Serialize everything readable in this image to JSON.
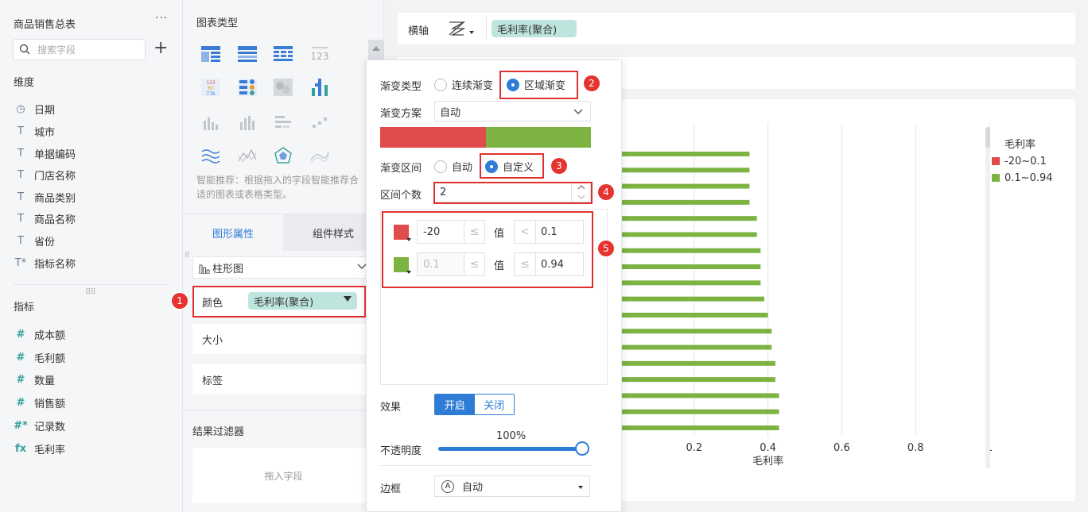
{
  "left": {
    "table_title": "商品销售总表",
    "more": "···",
    "search_placeholder": "搜索字段",
    "add": "+",
    "dimension_label": "维度",
    "dimensions": [
      {
        "icon": "clock-icon",
        "glyph": "◷",
        "label": "日期"
      },
      {
        "icon": "text-type-icon",
        "glyph": "T",
        "label": "城市"
      },
      {
        "icon": "text-type-icon",
        "glyph": "T",
        "label": "单据编码"
      },
      {
        "icon": "text-type-icon",
        "glyph": "T",
        "label": "门店名称"
      },
      {
        "icon": "text-type-icon",
        "glyph": "T",
        "label": "商品类别"
      },
      {
        "icon": "text-type-icon",
        "glyph": "T",
        "label": "商品名称"
      },
      {
        "icon": "text-type-icon",
        "glyph": "T",
        "label": "省份"
      },
      {
        "icon": "text-type-icon",
        "glyph": "T*",
        "label": "指标名称"
      }
    ],
    "measure_label": "指标",
    "measures": [
      {
        "icon": "number-type-icon",
        "glyph": "#",
        "label": "成本额"
      },
      {
        "icon": "number-type-icon",
        "glyph": "#",
        "label": "毛利额"
      },
      {
        "icon": "number-type-icon",
        "glyph": "#",
        "label": "数量"
      },
      {
        "icon": "number-type-icon",
        "glyph": "#",
        "label": "销售额"
      },
      {
        "icon": "number-type-icon",
        "glyph": "#*",
        "label": "记录数"
      },
      {
        "icon": "formula-icon",
        "glyph": "fx",
        "label": "毛利率"
      }
    ]
  },
  "mid": {
    "chart_type_title": "图表类型",
    "smart_tip": "智能推荐：根据拖入的字段智能推荐合适的图表或表格类型。",
    "tab_active": "图形属性",
    "tab_inactive": "组件样式",
    "chart_select": "柱形图",
    "color_label": "颜色",
    "color_field": "毛利率(聚合)",
    "size_label": "大小",
    "label_label": "标签",
    "filter_title": "结果过滤器",
    "drop_hint": "拖入字段"
  },
  "canvas": {
    "axis_label": "横轴",
    "axis_field": "毛利率(聚合)",
    "x_axis_title": "毛利率",
    "legend_title": "毛利率",
    "legend": [
      {
        "label": "-20~0.1",
        "color": "#e04b4b"
      },
      {
        "label": "0.1~0.94",
        "color": "#7cb342"
      }
    ]
  },
  "chart_data": {
    "type": "bar",
    "orientation": "horizontal",
    "xlabel": "毛利率",
    "x_ticks": [
      "0.2",
      "0.4",
      "0.6",
      "0.8",
      "1"
    ],
    "xlim": [
      0,
      1
    ],
    "values": [
      0.35,
      0.35,
      0.35,
      0.35,
      0.37,
      0.37,
      0.38,
      0.38,
      0.38,
      0.39,
      0.4,
      0.41,
      0.41,
      0.42,
      0.42,
      0.43,
      0.43,
      0.43
    ],
    "bar_color": "#7cb342",
    "grid": true
  },
  "popup": {
    "gradient_type_label": "渐变类型",
    "gradient_continuous": "连续渐变",
    "gradient_region": "区域渐变",
    "scheme_label": "渐变方案",
    "scheme_value": "自动",
    "gradient_colors": [
      "#e04b4b",
      "#7cb342"
    ],
    "interval_label": "渐变区间",
    "interval_auto": "自动",
    "interval_custom": "自定义",
    "count_label": "区间个数",
    "count_value": "2",
    "ranges": [
      {
        "color": "#e04b4b",
        "from": "-20",
        "op1": "≤",
        "val_label": "值",
        "op2": "<",
        "to": "0.1"
      },
      {
        "color": "#7cb342",
        "from": "0.1",
        "op1": "≤",
        "val_label": "值",
        "op2": "≤",
        "to": "0.94"
      }
    ],
    "effect_label": "效果",
    "effect_on": "开启",
    "effect_off": "关闭",
    "opacity_label": "不透明度",
    "opacity_value": "100%",
    "border_label": "边框",
    "border_value": "自动"
  },
  "annotations": [
    "1",
    "2",
    "3",
    "4",
    "5"
  ]
}
